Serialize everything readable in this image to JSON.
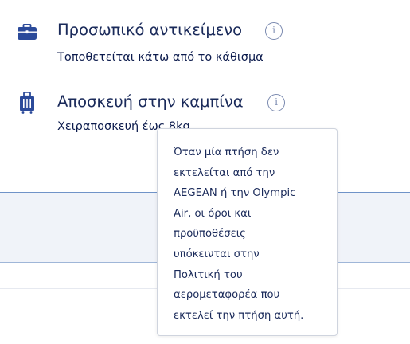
{
  "items": [
    {
      "title": "Προσωπικό αντικείμενο",
      "subtitle": "Τοποθετείται κάτω από το κάθισμα",
      "icon": "briefcase-icon",
      "info_symbol": "i"
    },
    {
      "title": "Αποσκευή στην καμπίνα",
      "subtitle": "Χειραποσκευή έως 8kg",
      "icon": "trolley-luggage-icon",
      "info_symbol": "i"
    }
  ],
  "tooltip": {
    "text": "Όταν μία πτήση δεν\nεκτελείται από την\nAEGEAN ή την Olympic\nAir, οι όροι και\nπροϋποθέσεις\nυπόκεινται στην\nΠολιτική του\nαερομεταφορέα που\nεκτελεί την πτήση αυτή."
  },
  "colors": {
    "text": "#1a2a5a",
    "icon": "#2b4a9a",
    "info_outline": "#7b8ab0",
    "band": "#f0f3f9"
  }
}
